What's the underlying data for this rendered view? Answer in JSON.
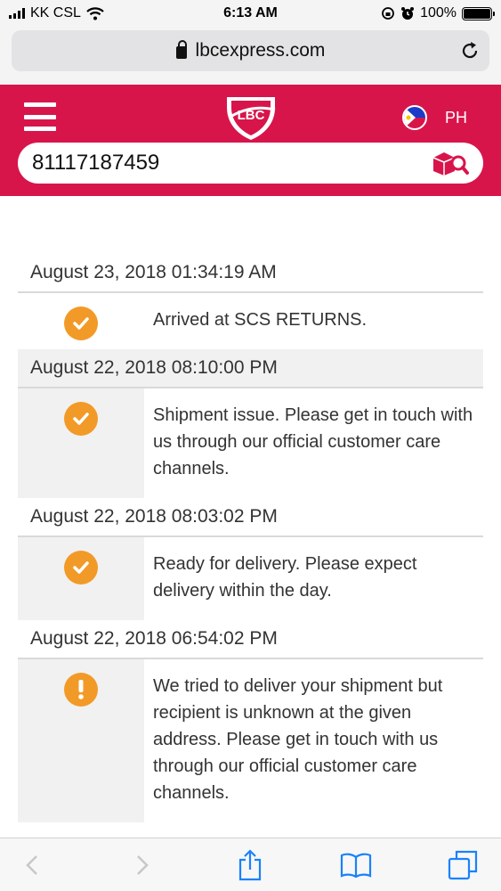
{
  "status_bar": {
    "carrier": "KK CSL",
    "time": "6:13 AM",
    "battery": "100%"
  },
  "browser": {
    "url": "lbcexpress.com"
  },
  "header": {
    "country_code": "PH"
  },
  "search": {
    "tracking_number": "81117187459"
  },
  "history": [
    {
      "date": "August 23, 2018 01:34:19 AM",
      "status": "Arrived at SCS RETURNS.",
      "icon": "check-icon"
    },
    {
      "date": "August 22, 2018 08:10:00 PM",
      "status": "Shipment issue. Please get in touch with us through our official customer care channels.",
      "icon": "check-icon"
    },
    {
      "date": "August 22, 2018 08:03:02 PM",
      "status": "Ready for delivery. Please expect delivery within the day.",
      "icon": "check-icon"
    },
    {
      "date": "August 22, 2018 06:54:02 PM",
      "status": "We tried to deliver your shipment but recipient is unknown at the given address. Please get in touch with us through our official customer care channels.",
      "icon": "exclamation-icon"
    }
  ],
  "colors": {
    "brand": "#d8154b",
    "status_icon": "#f29a27",
    "ios_blue": "#1a82fb"
  }
}
